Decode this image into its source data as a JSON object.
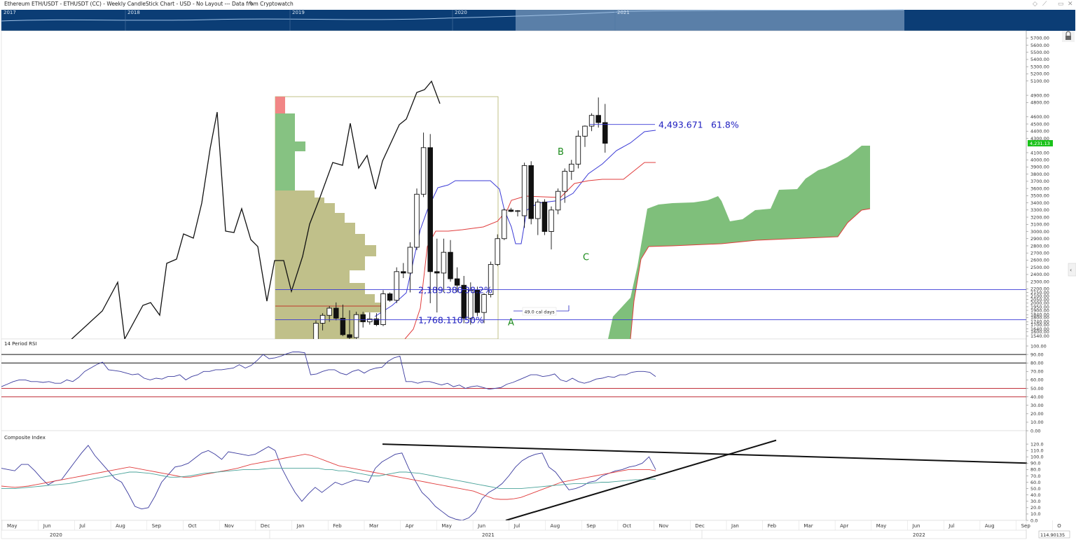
{
  "header": {
    "title": "Ethereum ETH/USDT - ETHUSDT (CC) - Weekly CandleStick Chart - USD - No Layout --- Data from Cryptowatch",
    "edit_icon": "pencil-icon",
    "window_icons": [
      "diamond-icon",
      "pin-icon",
      "restore-icon",
      "close-icon"
    ]
  },
  "navigator": {
    "years": [
      "2017",
      "2018",
      "2019",
      "2020",
      "2021"
    ]
  },
  "colors": {
    "navy": "#0b3d75",
    "ichimoku_cloud": "#7fbf7b",
    "kijun": "#e03c3c",
    "tenkan": "#3a3ad6",
    "volume_profile": "#bdbd84",
    "fib_line": "#3a3ad6",
    "price_badge": "#19c219",
    "rsi_line": "#3a3a9e",
    "ci_fast": "#e03c3c",
    "ci_slow": "#4aa39a"
  },
  "chart_data": [
    {
      "type": "candlestick",
      "title": "Ethereum ETH/USDT - ETHUSDT (CC) - Weekly CandleStick Chart - USD",
      "ylim": [
        1500,
        5800
      ],
      "y_ticks": [
        1540,
        1600,
        1640,
        1700,
        1740,
        1800,
        1840,
        1900,
        1950,
        2000,
        2050,
        2100,
        2150,
        2200,
        2300,
        2400,
        2500,
        2600,
        2700,
        2800,
        2900,
        3000,
        3100,
        3200,
        3300,
        3400,
        3500,
        3600,
        3700,
        3800,
        3900,
        4000,
        4100,
        4300,
        4400,
        4500,
        4600,
        4800,
        4900,
        5100,
        5200,
        5300,
        5400,
        5500,
        5600,
        5700
      ],
      "last_price_label": "4,231.13",
      "last_price": 4231.13,
      "x_months": [
        "May",
        "Jun",
        "Jul",
        "Aug",
        "Sep",
        "Oct",
        "Nov",
        "Dec",
        "Jan",
        "Feb",
        "Mar",
        "Apr",
        "May",
        "Jun",
        "Jul",
        "Aug",
        "Sep",
        "Oct",
        "Nov",
        "Dec",
        "Jan",
        "Feb",
        "Mar",
        "Apr",
        "May",
        "Jun",
        "Jul",
        "Aug",
        "Sep",
        "O"
      ],
      "x_years": [
        "2020",
        "2021",
        "2022"
      ],
      "candles": [
        {
          "o": 1400,
          "h": 1760,
          "l": 1320,
          "c": 1720
        },
        {
          "o": 1720,
          "h": 1860,
          "l": 1620,
          "c": 1830
        },
        {
          "o": 1830,
          "h": 1960,
          "l": 1740,
          "c": 1930
        },
        {
          "o": 1930,
          "h": 2010,
          "l": 1760,
          "c": 1790
        },
        {
          "o": 1790,
          "h": 1980,
          "l": 1540,
          "c": 1560
        },
        {
          "o": 1560,
          "h": 1900,
          "l": 1500,
          "c": 1520
        },
        {
          "o": 1520,
          "h": 1880,
          "l": 1500,
          "c": 1840
        },
        {
          "o": 1840,
          "h": 1880,
          "l": 1660,
          "c": 1740
        },
        {
          "o": 1740,
          "h": 1870,
          "l": 1700,
          "c": 1780
        },
        {
          "o": 1780,
          "h": 1860,
          "l": 1680,
          "c": 1700
        },
        {
          "o": 1700,
          "h": 2180,
          "l": 1680,
          "c": 2130
        },
        {
          "o": 2130,
          "h": 2150,
          "l": 2020,
          "c": 2040
        },
        {
          "o": 2040,
          "h": 2500,
          "l": 2000,
          "c": 2440
        },
        {
          "o": 2440,
          "h": 2560,
          "l": 2350,
          "c": 2420
        },
        {
          "o": 2420,
          "h": 2850,
          "l": 2150,
          "c": 2780
        },
        {
          "o": 2780,
          "h": 3600,
          "l": 2740,
          "c": 3520
        },
        {
          "o": 3520,
          "h": 4380,
          "l": 3480,
          "c": 4170
        },
        {
          "o": 4170,
          "h": 4360,
          "l": 2000,
          "c": 2440
        },
        {
          "o": 2440,
          "h": 2900,
          "l": 1870,
          "c": 2420
        },
        {
          "o": 2420,
          "h": 2900,
          "l": 2150,
          "c": 2710
        },
        {
          "o": 2710,
          "h": 2880,
          "l": 2300,
          "c": 2340
        },
        {
          "o": 2340,
          "h": 2500,
          "l": 2150,
          "c": 2250
        },
        {
          "o": 2250,
          "h": 2380,
          "l": 1720,
          "c": 1790
        },
        {
          "o": 1790,
          "h": 2290,
          "l": 1700,
          "c": 2180
        },
        {
          "o": 2180,
          "h": 2230,
          "l": 1820,
          "c": 1870
        },
        {
          "o": 1870,
          "h": 2140,
          "l": 1720,
          "c": 2120
        },
        {
          "o": 2120,
          "h": 2580,
          "l": 2080,
          "c": 2540
        },
        {
          "o": 2540,
          "h": 2960,
          "l": 2520,
          "c": 2900
        },
        {
          "o": 2900,
          "h": 3320,
          "l": 2880,
          "c": 3300
        },
        {
          "o": 3300,
          "h": 3330,
          "l": 3270,
          "c": 3280
        },
        {
          "o": 3280,
          "h": 3300,
          "l": 3210,
          "c": 3290
        },
        {
          "o": 3220,
          "h": 3960,
          "l": 3050,
          "c": 3920
        },
        {
          "o": 3920,
          "h": 3980,
          "l": 3100,
          "c": 3180
        },
        {
          "o": 3180,
          "h": 3450,
          "l": 2950,
          "c": 3410
        },
        {
          "o": 3410,
          "h": 3450,
          "l": 2950,
          "c": 3000
        },
        {
          "o": 3000,
          "h": 3350,
          "l": 2750,
          "c": 3300
        },
        {
          "o": 3300,
          "h": 3600,
          "l": 3240,
          "c": 3560
        },
        {
          "o": 3560,
          "h": 3880,
          "l": 3400,
          "c": 3840
        },
        {
          "o": 3840,
          "h": 4000,
          "l": 3720,
          "c": 3940
        },
        {
          "o": 3940,
          "h": 4410,
          "l": 3880,
          "c": 4330
        },
        {
          "o": 4330,
          "h": 4480,
          "l": 4180,
          "c": 4470
        },
        {
          "o": 4470,
          "h": 4650,
          "l": 4400,
          "c": 4620
        },
        {
          "o": 4620,
          "h": 4870,
          "l": 4450,
          "c": 4520
        },
        {
          "o": 4520,
          "h": 4780,
          "l": 4100,
          "c": 4231
        }
      ],
      "fib_levels": [
        {
          "label": "4,493.671",
          "pct": "61.8%",
          "value": 4493.671
        },
        {
          "label": "2,189.380",
          "pct": "38.2%",
          "value": 2189.38
        },
        {
          "label": "1,768.110",
          "pct": "50%",
          "value": 1768.11
        }
      ],
      "annotations": [
        {
          "text": "A",
          "price": 1730
        },
        {
          "text": "B",
          "price": 4110
        },
        {
          "text": "C",
          "price": 2640
        }
      ],
      "time_measure_label": "49.0 cal days"
    },
    {
      "type": "line",
      "title": "14 Period RSI",
      "ylim": [
        0,
        100
      ],
      "y_ticks": [
        0,
        10,
        20,
        30,
        40,
        50,
        60,
        70,
        80,
        90,
        100
      ],
      "y_tick_labels": [
        "0.00",
        "10.00",
        "20.00",
        "30.00",
        "40.00",
        "50.00",
        "60.00",
        "70.00",
        "80.00",
        "90.00",
        "100.00"
      ],
      "levels_black": [
        90,
        80
      ],
      "levels_red": [
        50,
        40
      ],
      "values": [
        52,
        55,
        58,
        60,
        60,
        58,
        58,
        57,
        58,
        56,
        56,
        60,
        58,
        63,
        70,
        74,
        78,
        81,
        72,
        71,
        70,
        68,
        66,
        67,
        62,
        60,
        62,
        61,
        64,
        64,
        66,
        60,
        64,
        66,
        70,
        70,
        72,
        72,
        73,
        74,
        78,
        74,
        77,
        83,
        90,
        85,
        86,
        88,
        91,
        93,
        93,
        92,
        66,
        67,
        70,
        72,
        72,
        68,
        66,
        70,
        72,
        68,
        72,
        74,
        75,
        82,
        86,
        88,
        58,
        58,
        56,
        58,
        58,
        56,
        54,
        56,
        52,
        54,
        50,
        52,
        53,
        51,
        49,
        50,
        51,
        55,
        57,
        60,
        63,
        66,
        66,
        64,
        65,
        67,
        60,
        58,
        62,
        58,
        56,
        58,
        61,
        62,
        64,
        63,
        66,
        66,
        69,
        70,
        70,
        69,
        64
      ]
    },
    {
      "type": "line",
      "title": "Composite Index",
      "ylim": [
        0,
        130
      ],
      "y_ticks": [
        0,
        10,
        20,
        30,
        40,
        50,
        60,
        70,
        80,
        90,
        100,
        110,
        120
      ],
      "y_tick_labels": [
        "0.0",
        "10.0",
        "20.0",
        "30.0",
        "40.0",
        "50.0",
        "60.0",
        "70.0",
        "80.0",
        "90.0",
        "100.0",
        "110.0",
        "120.0"
      ],
      "series": [
        {
          "values": [
            82,
            80,
            78,
            88,
            88,
            78,
            66,
            56,
            62,
            64,
            78,
            92,
            106,
            118,
            102,
            90,
            78,
            66,
            60,
            42,
            22,
            18,
            20,
            38,
            60,
            72,
            84,
            86,
            90,
            98,
            106,
            110,
            104,
            96,
            108,
            106,
            104,
            102,
            104,
            110,
            116,
            110,
            82,
            62,
            44,
            30,
            42,
            52,
            44,
            52,
            60,
            56,
            60,
            64,
            62,
            60,
            82,
            92,
            98,
            104,
            106,
            82,
            62,
            44,
            34,
            22,
            14,
            6,
            2,
            0,
            4,
            14,
            34,
            44,
            50,
            58,
            70,
            84,
            94,
            100,
            104,
            106,
            84,
            76,
            62,
            48,
            50,
            54,
            60,
            62,
            70,
            74,
            78,
            80,
            84,
            86,
            90,
            100,
            80
          ]
        },
        {
          "values": [
            54,
            53,
            52,
            53,
            54,
            56,
            58,
            60,
            62,
            64,
            66,
            68,
            70,
            72,
            74,
            76,
            78,
            80,
            82,
            84,
            82,
            80,
            78,
            76,
            74,
            72,
            70,
            68,
            68,
            70,
            72,
            74,
            76,
            78,
            80,
            82,
            85,
            88,
            90,
            92,
            94,
            96,
            98,
            100,
            102,
            104,
            102,
            98,
            94,
            90,
            86,
            84,
            82,
            80,
            78,
            76,
            74,
            72,
            70,
            68,
            66,
            64,
            62,
            60,
            58,
            56,
            54,
            52,
            50,
            48,
            46,
            42,
            38,
            34,
            33,
            33,
            34,
            36,
            40,
            44,
            48,
            52,
            56,
            60,
            62,
            64,
            66,
            68,
            70,
            72,
            74,
            76,
            78,
            80,
            80,
            80,
            80,
            78
          ]
        },
        {
          "values": [
            50,
            50,
            50,
            51,
            52,
            53,
            54,
            55,
            56,
            57,
            58,
            60,
            62,
            64,
            66,
            68,
            70,
            72,
            74,
            76,
            76,
            75,
            74,
            72,
            70,
            68,
            68,
            69,
            70,
            72,
            74,
            75,
            76,
            77,
            78,
            79,
            80,
            80,
            80,
            81,
            82,
            82,
            82,
            82,
            82,
            82,
            82,
            82,
            80,
            80,
            78,
            78,
            76,
            74,
            72,
            70,
            70,
            72,
            74,
            76,
            76,
            75,
            74,
            72,
            70,
            68,
            66,
            64,
            62,
            60,
            58,
            56,
            54,
            52,
            50,
            50,
            50,
            50,
            51,
            52,
            53,
            54,
            55,
            56,
            57,
            58,
            58,
            58,
            59,
            60,
            60,
            61,
            62,
            63,
            64,
            64,
            65,
            65
          ]
        }
      ],
      "trendlines": [
        {
          "from": {
            "x": 546,
            "y": 120
          },
          "to": {
            "x": 1466,
            "y": 90
          }
        },
        {
          "from": {
            "x": 722,
            "y": 0
          },
          "to": {
            "x": 1108,
            "y": 126
          }
        }
      ],
      "last_value_label": "114.90135"
    }
  ]
}
